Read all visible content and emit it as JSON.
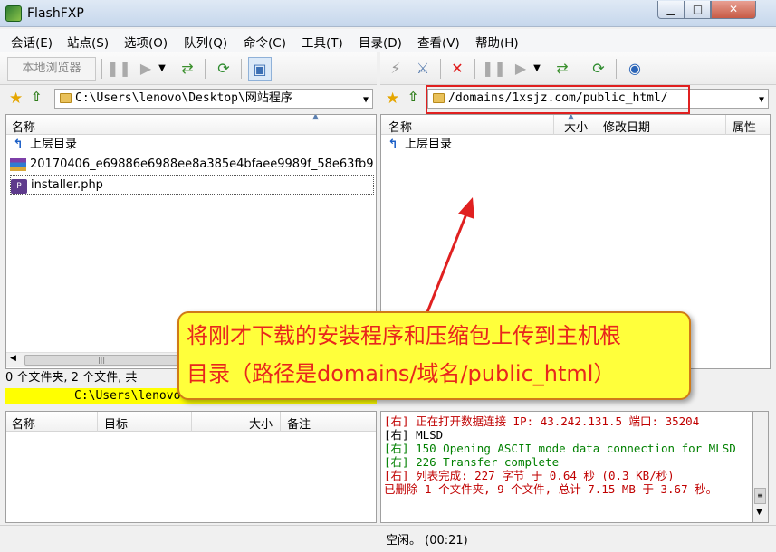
{
  "window": {
    "title": "FlashFXP",
    "minimize": "▁",
    "maximize": "□",
    "close": "✕"
  },
  "menu": [
    "会话(E)",
    "站点(S)",
    "选项(O)",
    "队列(Q)",
    "命令(C)",
    "工具(T)",
    "目录(D)",
    "查看(V)",
    "帮助(H)"
  ],
  "local_toolbar": {
    "browser_label": "本地浏览器"
  },
  "local": {
    "path": "C:\\Users\\lenovo\\Desktop\\网站程序",
    "col_name": "名称",
    "rows": [
      {
        "icon": "up-arrow-icon",
        "name": "上层目录"
      },
      {
        "icon": "archive-icon",
        "name": "20170406_e69886e6988ee8a385e4bfaee9989f_58e63fb9"
      },
      {
        "icon": "php-file-icon",
        "name": "installer.php"
      }
    ],
    "status": "0 个文件夹, 2 个文件, 共",
    "path_bar": "C:\\Users\\lenovo"
  },
  "remote": {
    "path": "/domains/1xsjz.com/public_html/",
    "col_name": "名称",
    "col_size": "大小",
    "col_date": "修改日期",
    "col_attr": "属性",
    "rows": [
      {
        "icon": "up-arrow-icon",
        "name": "上层目录"
      }
    ]
  },
  "queue": {
    "col_name": "名称",
    "col_target": "目标",
    "col_size": "大小",
    "col_note": "备注"
  },
  "log": [
    {
      "text": "[右] 正在打开数据连接 IP: 43.242.131.5 端口: 35204",
      "color": "#c00000"
    },
    {
      "text": "[右] MLSD",
      "color": "#000000"
    },
    {
      "text": "[右] 150 Opening ASCII mode data connection for MLSD",
      "color": "#008000"
    },
    {
      "text": "[右] 226 Transfer complete",
      "color": "#008000"
    },
    {
      "text": "[右] 列表完成: 227 字节 于 0.64 秒 (0.3 KB/秒)",
      "color": "#c00000"
    },
    {
      "text": "已删除 1 个文件夹, 9 个文件, 总计 7.15 MB 于 3.67 秒。",
      "color": "#c00000"
    }
  ],
  "statusbar": {
    "text": "空闲。 (00:21)"
  },
  "annotation": {
    "line1": "将刚才下载的安装程序和压缩包上传到主机根",
    "line2": "目录（路径是domains/域名/public_html）"
  },
  "colors": {
    "annotation_bg": "#ffff3b",
    "annotation_text": "#e8261d",
    "highlight": "#e02020",
    "local_path_bar": "#ffff00"
  }
}
